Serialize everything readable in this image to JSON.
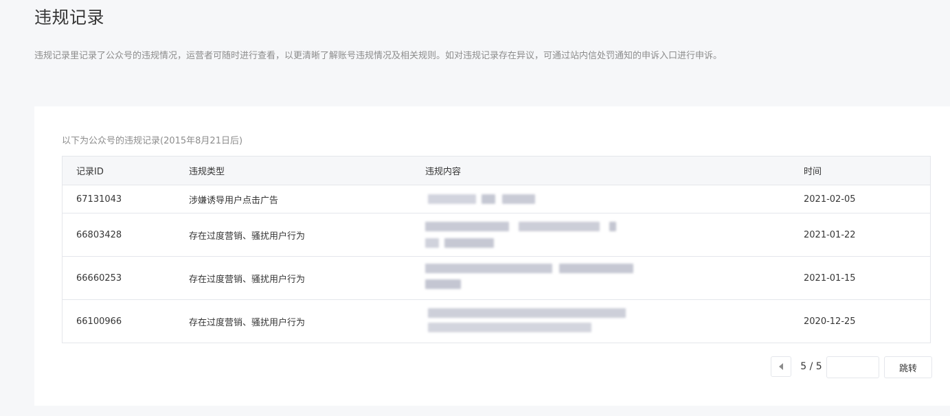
{
  "page": {
    "title": "违规记录",
    "description": "违规记录里记录了公众号的违规情况，运营者可随时进行查看，以更清晰了解账号违规情况及相关规则。如对违规记录存在异议，可通过站内信处罚通知的申诉入口进行申诉。"
  },
  "records": {
    "caption": "以下为公众号的违规记录(2015年8月21日后)",
    "columns": {
      "id": "记录ID",
      "type": "违规类型",
      "content": "违规内容",
      "time": "时间"
    },
    "rows": [
      {
        "id": "67131043",
        "type": "涉嫌诱导用户点击广告",
        "time": "2021-02-05"
      },
      {
        "id": "66803428",
        "type": "存在过度营销、骚扰用户行为",
        "time": "2021-01-22"
      },
      {
        "id": "66660253",
        "type": "存在过度营销、骚扰用户行为",
        "time": "2021-01-15"
      },
      {
        "id": "66100966",
        "type": "存在过度营销、骚扰用户行为",
        "time": "2020-12-25"
      }
    ]
  },
  "pagination": {
    "page_indicator": "5 / 5",
    "jump_input_value": "",
    "jump_button_label": "跳转"
  },
  "colors": {
    "background": "#f6f7f9",
    "card": "#ffffff",
    "border": "#e4e6eb",
    "text": "#353535",
    "muted": "#8c8c8c",
    "blur": "#c9cbd6"
  }
}
